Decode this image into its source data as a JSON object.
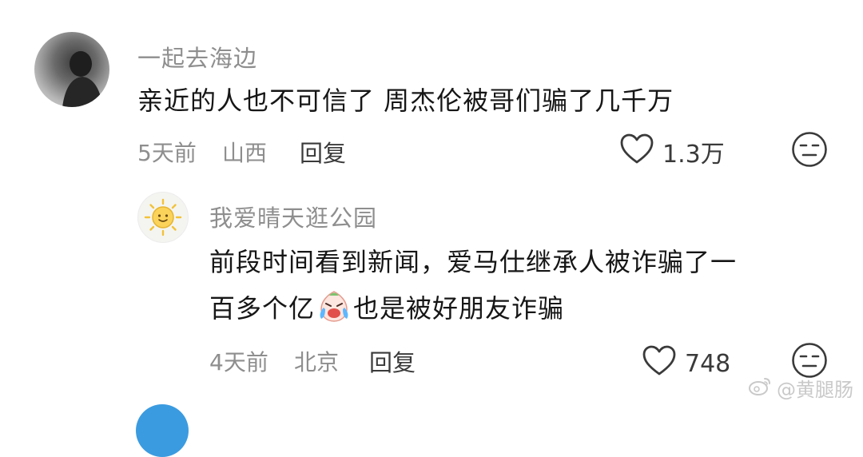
{
  "comments": [
    {
      "username": "一起去海边",
      "text": "亲近的人也不可信了  周杰伦被哥们骗了几千万",
      "time": "5天前",
      "location": "山西",
      "reply_label": "回复",
      "likes": "1.3万"
    },
    {
      "username": "我爱晴天逛公园",
      "text_line1": "前段时间看到新闻，爱马仕继承人被诈骗了一",
      "text_line2_before": "百多个亿",
      "text_line2_after": "也是被好朋友诈骗",
      "time": "4天前",
      "location": "北京",
      "reply_label": "回复",
      "likes": "748"
    }
  ],
  "watermark": "@黄腿肠"
}
